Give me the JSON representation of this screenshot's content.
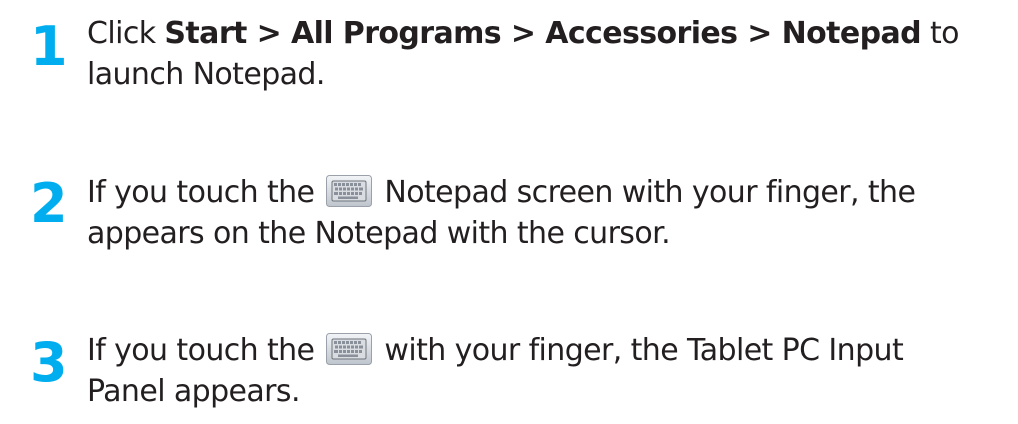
{
  "steps": [
    {
      "number": "1",
      "line1_pre": "Click ",
      "line1_bold": "Start > All Programs > Accessories > Notepad",
      "line1_post": " to",
      "line2": "launch Notepad."
    },
    {
      "number": "2",
      "line1_pre": "If you touch the",
      "line1_icon": "keyboard-icon",
      "line1_post": "Notepad screen with your finger, the",
      "line2": "appears on the Notepad with the cursor."
    },
    {
      "number": "3",
      "line1_pre": "If you touch the",
      "line1_icon": "keyboard-icon",
      "line1_post": "with your finger, the Tablet PC Input",
      "line2": "Panel appears."
    }
  ],
  "colors": {
    "step_number": "#00aeef",
    "text": "#231f20"
  }
}
